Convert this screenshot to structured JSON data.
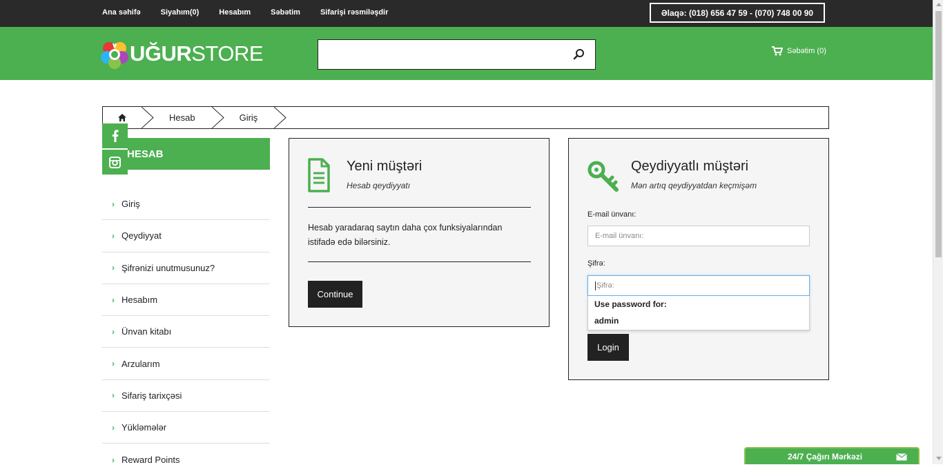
{
  "topbar": {
    "nav": [
      "Ana səhifə",
      "Siyahım(0)",
      "Hesabım",
      "Səbətim",
      "Sifarişi rəsmiləşdir"
    ],
    "contact": "Əlaqə: (018) 656 47 59 - (070) 748 00 90"
  },
  "header": {
    "logo_bold": "UĞUR",
    "logo_light": "STORE",
    "search_value": "",
    "cart_label": "Səbətim (0)"
  },
  "breadcrumb": {
    "items": [
      "Hesab",
      "Giriş"
    ]
  },
  "sidebar": {
    "title": "HESAB",
    "items": [
      "Giriş",
      "Qeydiyyat",
      "Şifrənizi unutmusunuz?",
      "Hesabım",
      "Ünvan kitabı",
      "Arzularım",
      "Sifariş tarixçəsi",
      "Yükləmələr",
      "Reward Points"
    ]
  },
  "new_customer": {
    "title": "Yeni müştəri",
    "subtitle": "Hesab qeydiyyatı",
    "description": "Hesab yaradaraq saytın daha çox funksiyalarından istifadə edə bilərsiniz.",
    "button": "Continue"
  },
  "returning_customer": {
    "title": "Qeydiyyatlı müştəri",
    "subtitle": "Mən artıq qeydiyyatdan keçmişəm",
    "email_label": "E-mail ünvanı:",
    "email_placeholder": "E-mail ünvanı:",
    "password_label": "Şifrə:",
    "password_placeholder": "Şifrə:",
    "autocomplete_title": "Use password for:",
    "autocomplete_item": "admin",
    "button": "Login"
  },
  "chat": {
    "label": "24/7 Çağırı Mərkəzi"
  },
  "colors": {
    "brand_green": "#4caf50",
    "dark": "#2a2a2a"
  }
}
